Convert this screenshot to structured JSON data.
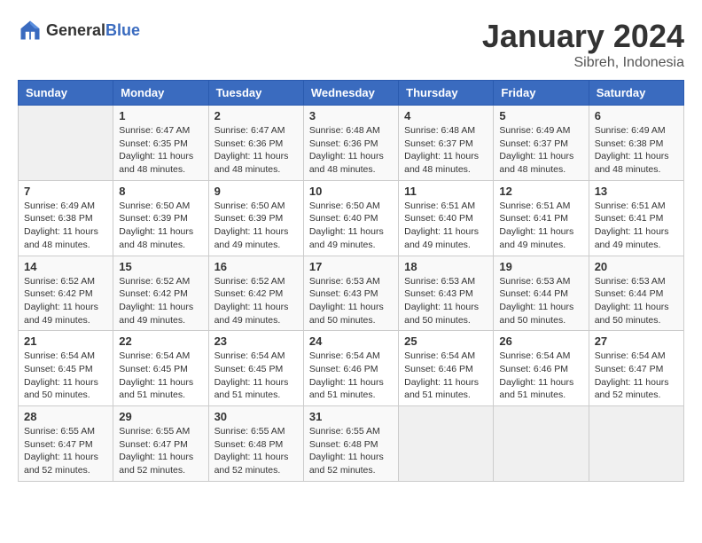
{
  "header": {
    "logo_general": "General",
    "logo_blue": "Blue",
    "month_year": "January 2024",
    "location": "Sibreh, Indonesia"
  },
  "weekdays": [
    "Sunday",
    "Monday",
    "Tuesday",
    "Wednesday",
    "Thursday",
    "Friday",
    "Saturday"
  ],
  "weeks": [
    [
      {
        "day": "",
        "empty": true
      },
      {
        "day": "1",
        "sunrise": "Sunrise: 6:47 AM",
        "sunset": "Sunset: 6:35 PM",
        "daylight": "Daylight: 11 hours and 48 minutes."
      },
      {
        "day": "2",
        "sunrise": "Sunrise: 6:47 AM",
        "sunset": "Sunset: 6:36 PM",
        "daylight": "Daylight: 11 hours and 48 minutes."
      },
      {
        "day": "3",
        "sunrise": "Sunrise: 6:48 AM",
        "sunset": "Sunset: 6:36 PM",
        "daylight": "Daylight: 11 hours and 48 minutes."
      },
      {
        "day": "4",
        "sunrise": "Sunrise: 6:48 AM",
        "sunset": "Sunset: 6:37 PM",
        "daylight": "Daylight: 11 hours and 48 minutes."
      },
      {
        "day": "5",
        "sunrise": "Sunrise: 6:49 AM",
        "sunset": "Sunset: 6:37 PM",
        "daylight": "Daylight: 11 hours and 48 minutes."
      },
      {
        "day": "6",
        "sunrise": "Sunrise: 6:49 AM",
        "sunset": "Sunset: 6:38 PM",
        "daylight": "Daylight: 11 hours and 48 minutes."
      }
    ],
    [
      {
        "day": "7",
        "sunrise": "Sunrise: 6:49 AM",
        "sunset": "Sunset: 6:38 PM",
        "daylight": "Daylight: 11 hours and 48 minutes."
      },
      {
        "day": "8",
        "sunrise": "Sunrise: 6:50 AM",
        "sunset": "Sunset: 6:39 PM",
        "daylight": "Daylight: 11 hours and 48 minutes."
      },
      {
        "day": "9",
        "sunrise": "Sunrise: 6:50 AM",
        "sunset": "Sunset: 6:39 PM",
        "daylight": "Daylight: 11 hours and 49 minutes."
      },
      {
        "day": "10",
        "sunrise": "Sunrise: 6:50 AM",
        "sunset": "Sunset: 6:40 PM",
        "daylight": "Daylight: 11 hours and 49 minutes."
      },
      {
        "day": "11",
        "sunrise": "Sunrise: 6:51 AM",
        "sunset": "Sunset: 6:40 PM",
        "daylight": "Daylight: 11 hours and 49 minutes."
      },
      {
        "day": "12",
        "sunrise": "Sunrise: 6:51 AM",
        "sunset": "Sunset: 6:41 PM",
        "daylight": "Daylight: 11 hours and 49 minutes."
      },
      {
        "day": "13",
        "sunrise": "Sunrise: 6:51 AM",
        "sunset": "Sunset: 6:41 PM",
        "daylight": "Daylight: 11 hours and 49 minutes."
      }
    ],
    [
      {
        "day": "14",
        "sunrise": "Sunrise: 6:52 AM",
        "sunset": "Sunset: 6:42 PM",
        "daylight": "Daylight: 11 hours and 49 minutes."
      },
      {
        "day": "15",
        "sunrise": "Sunrise: 6:52 AM",
        "sunset": "Sunset: 6:42 PM",
        "daylight": "Daylight: 11 hours and 49 minutes."
      },
      {
        "day": "16",
        "sunrise": "Sunrise: 6:52 AM",
        "sunset": "Sunset: 6:42 PM",
        "daylight": "Daylight: 11 hours and 49 minutes."
      },
      {
        "day": "17",
        "sunrise": "Sunrise: 6:53 AM",
        "sunset": "Sunset: 6:43 PM",
        "daylight": "Daylight: 11 hours and 50 minutes."
      },
      {
        "day": "18",
        "sunrise": "Sunrise: 6:53 AM",
        "sunset": "Sunset: 6:43 PM",
        "daylight": "Daylight: 11 hours and 50 minutes."
      },
      {
        "day": "19",
        "sunrise": "Sunrise: 6:53 AM",
        "sunset": "Sunset: 6:44 PM",
        "daylight": "Daylight: 11 hours and 50 minutes."
      },
      {
        "day": "20",
        "sunrise": "Sunrise: 6:53 AM",
        "sunset": "Sunset: 6:44 PM",
        "daylight": "Daylight: 11 hours and 50 minutes."
      }
    ],
    [
      {
        "day": "21",
        "sunrise": "Sunrise: 6:54 AM",
        "sunset": "Sunset: 6:45 PM",
        "daylight": "Daylight: 11 hours and 50 minutes."
      },
      {
        "day": "22",
        "sunrise": "Sunrise: 6:54 AM",
        "sunset": "Sunset: 6:45 PM",
        "daylight": "Daylight: 11 hours and 51 minutes."
      },
      {
        "day": "23",
        "sunrise": "Sunrise: 6:54 AM",
        "sunset": "Sunset: 6:45 PM",
        "daylight": "Daylight: 11 hours and 51 minutes."
      },
      {
        "day": "24",
        "sunrise": "Sunrise: 6:54 AM",
        "sunset": "Sunset: 6:46 PM",
        "daylight": "Daylight: 11 hours and 51 minutes."
      },
      {
        "day": "25",
        "sunrise": "Sunrise: 6:54 AM",
        "sunset": "Sunset: 6:46 PM",
        "daylight": "Daylight: 11 hours and 51 minutes."
      },
      {
        "day": "26",
        "sunrise": "Sunrise: 6:54 AM",
        "sunset": "Sunset: 6:46 PM",
        "daylight": "Daylight: 11 hours and 51 minutes."
      },
      {
        "day": "27",
        "sunrise": "Sunrise: 6:54 AM",
        "sunset": "Sunset: 6:47 PM",
        "daylight": "Daylight: 11 hours and 52 minutes."
      }
    ],
    [
      {
        "day": "28",
        "sunrise": "Sunrise: 6:55 AM",
        "sunset": "Sunset: 6:47 PM",
        "daylight": "Daylight: 11 hours and 52 minutes."
      },
      {
        "day": "29",
        "sunrise": "Sunrise: 6:55 AM",
        "sunset": "Sunset: 6:47 PM",
        "daylight": "Daylight: 11 hours and 52 minutes."
      },
      {
        "day": "30",
        "sunrise": "Sunrise: 6:55 AM",
        "sunset": "Sunset: 6:48 PM",
        "daylight": "Daylight: 11 hours and 52 minutes."
      },
      {
        "day": "31",
        "sunrise": "Sunrise: 6:55 AM",
        "sunset": "Sunset: 6:48 PM",
        "daylight": "Daylight: 11 hours and 52 minutes."
      },
      {
        "day": "",
        "empty": true
      },
      {
        "day": "",
        "empty": true
      },
      {
        "day": "",
        "empty": true
      }
    ]
  ]
}
